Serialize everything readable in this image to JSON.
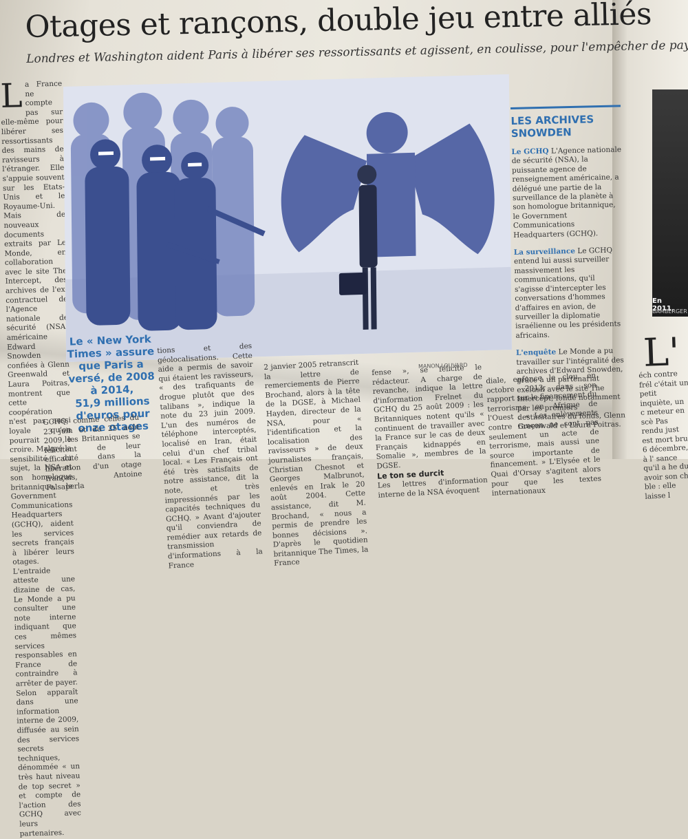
{
  "article": {
    "headline": "Otages et rançons, double jeu entre alliés",
    "subhead": "Londres et Washington aident Paris à libérer ses ressortissants et agissent, en coulisse, pour l'empêcher de payer",
    "dropcap": "L",
    "left_column_text": "a France ne compte pas sur elle-même pour libérer ses ressortissants des mains de ravisseurs à l'étranger. Elle s'appuie souvent sur les Etats-Unis et le Royaume-Uni. Mais de nouveaux documents extraits par Le Monde, en collaboration avec le site The Intercept, des archives de l'ex-contractuel de l'Agence nationale de sécurité (NSA) américaine Edward Snowden confiées à Glenn Greenwald et Laura Poitras, montrent que cette coopération n'est pas aussi loyale qu'on pourrait le croire. Malgré la sensibilité du sujet, la NSA et son homologue britannique, le Government Communications Headquarters (GCHQ), aident les services secrets français à libérer leurs otages. L'entraide atteste une dizaine de cas, Le Monde a pu consulter une note interne indiquant que ces mêmes services responsables en France de contraindre à arrêter de payer. Selon apparaît dans une information interne de 2009, diffusée au sein des services secrets techniques, dénommée « un très haut niveau de top secret » et compte de l'action des GCHQ avec leurs partenaires.",
    "illustration_credit": "MANON LOUVARD",
    "pull_quote": "Le « New York Times » assure que Paris a versé, de 2008 à 2014,",
    "pull_quote_figure": "51,9 millions d'euros pour onze otages"
  },
  "sidebar": {
    "title": "LES ARCHIVES SNOWDEN",
    "paragraphs": [
      {
        "lead": "Le GCHQ",
        "text": " L'Agence nationale de sécurité (NSA), la puissante agence de renseignement américaine, a délégué une partie de la surveillance de la planète à son homologue britannique, le Government Communications Headquarters (GCHQ)."
      },
      {
        "lead": "La surveillance",
        "text": " Le GCHQ entend lui aussi surveiller massivement les communications, qu'il s'agisse d'intercepter les conversations d'hommes d'affaires en avion, de surveiller la diplomatie israélienne ou les présidents africains."
      },
      {
        "lead": "L'enquête",
        "text": " Le Monde a pu travailler sur l'intégralité des archives d'Edward Snowden, grâce à un partenariat exclusif avec le site The Intercept, fondé notamment par les premiers destinataires du fonds, Glenn Greenwald et Laura Poitras."
      }
    ]
  },
  "bottom": {
    "col1": "GCHQ, comme celles du 23 juin et du 25 août 2009, les Britanniques se félicitent de leur efficacité dans la libération d'un otage français, Antoine Falsaperla",
    "col2": "tions et des géolocalisations. Cette aide a permis de savoir qui étaient les ravisseurs, « des trafiquants de drogue plutôt que des talibans », indique la note du 23 juin 2009. L'un des numéros de téléphone interceptés, localisé en Iran, était celui d'un chef tribal local. « Les Français ont été très satisfaits de notre assistance, dit la note, et très impressionnés par les capacités techniques du GCHQ. » Avant d'ajouter qu'il conviendra de remédier aux retards de transmission d'informations à la France",
    "col3": "2 janvier 2005 retranscrit la lettre de remerciements de Pierre Brochand, alors à la tête de la DGSE, à Michael Hayden, directeur de la NSA, pour « l'identification et la localisation des ravisseurs » de deux journalistes français, Christian Chesnot et Georges Malbrunot, enlevés en Irak le 20 août 2004. Cette assistance, dit M. Brochand, « nous a permis de prendre les bonnes décisions ». D'après le quotidien britannique The Times, la France",
    "col4_pre": "fense », se félicite le rédacteur. A charge de revanche, indique la lettre d'information Frelnet du GCHQ du 25 août 2009 : les Britanniques notent qu'ils « continuent de travailler avec la France sur le cas de deux Français kidnappés en Somalie », membres de la DGSE.",
    "col4_subhead": "Le ton se durcit",
    "col4_post": "Les lettres d'information interne de la NSA évoquent",
    "col5": "diale, enfonce le clou, en octobre 2013, dans son rapport sur le financement du terrorisme en Afrique de l'Ouest : « Les enlèvements contre rançon ne sont pas seulement un acte de terrorisme, mais aussi une source importante de financement. » L'Elysée et le Quai d'Orsay s'agitent alors pour que les textes internationaux",
    "right_dropcap": "L'",
    "right_text": "éch contre frél c'était un petit inquiète, un c meteur en scè Pas rendu just est mort bru 6 décembre, à l' sance qu'il a he du avoir son che ble : elle laisse l"
  },
  "photo": {
    "caption": "En 2011,",
    "credit": "BAMBERGER"
  },
  "colors": {
    "accent_blue": "#2f6fb0",
    "illustration_blue": "#3b4f8f",
    "paper": "#ebe8df"
  }
}
